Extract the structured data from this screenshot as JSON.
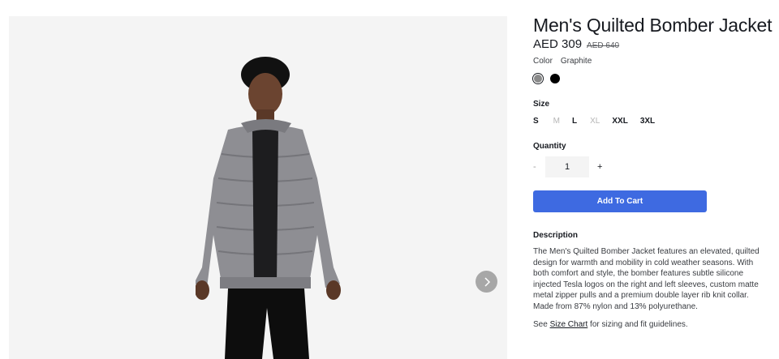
{
  "product": {
    "title": "Men's Quilted Bomber Jacket",
    "price": "AED 309",
    "original_price": "AED 640"
  },
  "color": {
    "label": "Color",
    "selected": "Graphite",
    "swatches": [
      {
        "name": "Graphite",
        "hex": "#8a8a8a"
      },
      {
        "name": "Black",
        "hex": "#000000"
      }
    ]
  },
  "size": {
    "label": "Size",
    "options": [
      {
        "label": "S",
        "available": true
      },
      {
        "label": "M",
        "available": false
      },
      {
        "label": "L",
        "available": true
      },
      {
        "label": "XL",
        "available": false
      },
      {
        "label": "XXL",
        "available": true
      },
      {
        "label": "3XL",
        "available": true
      }
    ]
  },
  "quantity": {
    "label": "Quantity",
    "minus": "-",
    "value": "1",
    "plus": "+"
  },
  "cart": {
    "button_label": "Add To Cart",
    "accent": "#3e6ae1"
  },
  "description": {
    "heading": "Description",
    "body": "The Men's Quilted Bomber Jacket features an elevated, quilted design for warmth and mobility in cold weather seasons. With both comfort and style, the bomber features subtle silicone injected Tesla logos on the right and left sleeves, custom matte metal zipper pulls and a premium double layer rib knit collar. Made from 87% nylon and 13% polyurethane.",
    "size_chart_prefix": "See ",
    "size_chart_link": "Size Chart",
    "size_chart_suffix": " for sizing and fit guidelines."
  },
  "gallery": {
    "next_icon": "chevron-right-icon"
  }
}
